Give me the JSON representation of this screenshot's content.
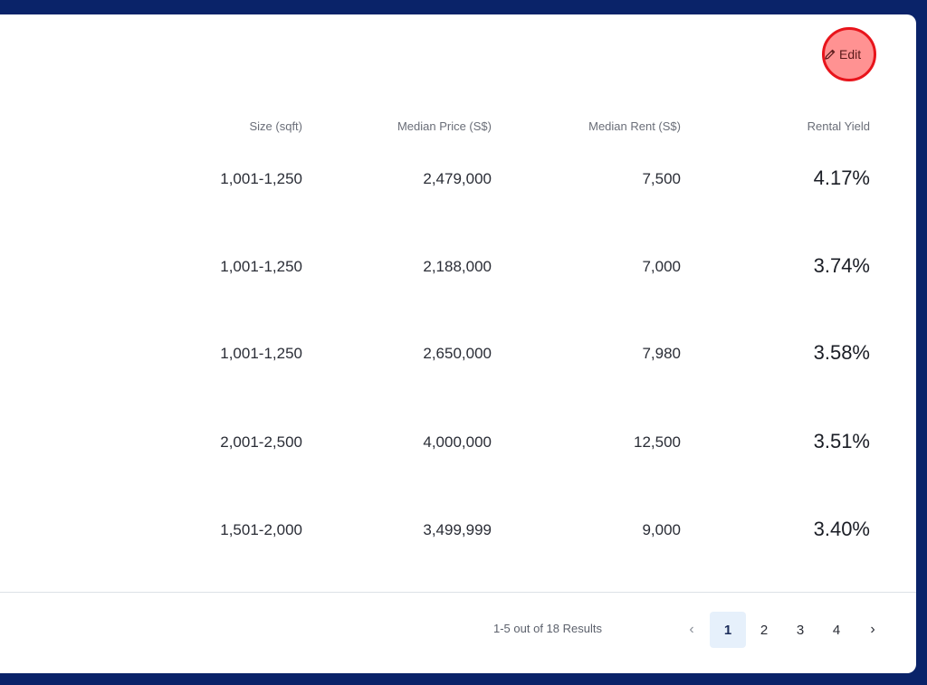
{
  "edit": {
    "label": "Edit"
  },
  "table": {
    "headers": {
      "size": "Size (sqft)",
      "price": "Median Price (S$)",
      "rent": "Median Rent (S$)",
      "yield": "Rental Yield"
    },
    "rows": [
      {
        "size": "1,001-1,250",
        "price": "2,479,000",
        "rent": "7,500",
        "yield": "4.17%"
      },
      {
        "size": "1,001-1,250",
        "price": "2,188,000",
        "rent": "7,000",
        "yield": "3.74%"
      },
      {
        "size": "1,001-1,250",
        "price": "2,650,000",
        "rent": "7,980",
        "yield": "3.58%"
      },
      {
        "size": "2,001-2,500",
        "price": "4,000,000",
        "rent": "12,500",
        "yield": "3.51%"
      },
      {
        "size": "1,501-2,000",
        "price": "3,499,999",
        "rent": "9,000",
        "yield": "3.40%"
      }
    ]
  },
  "pagination": {
    "summary": "1-5 out of 18 Results",
    "prev": "‹",
    "next": "›",
    "pages": [
      "1",
      "2",
      "3",
      "4"
    ],
    "current": "1"
  },
  "colors": {
    "background": "#0a2369",
    "highlight_border": "#e8141b",
    "active_page_bg": "#e6f0fb"
  }
}
